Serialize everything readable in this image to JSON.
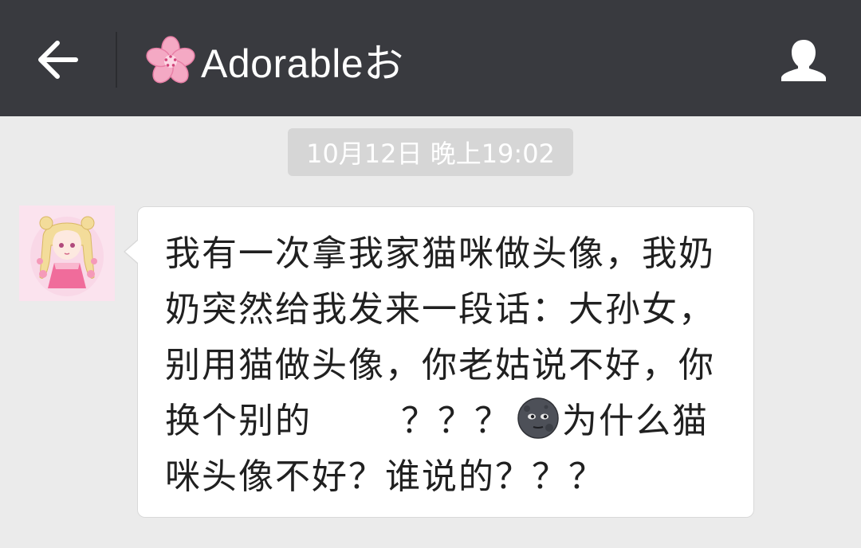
{
  "header": {
    "title": "Adorableお",
    "title_icon": "cherry-blossom-icon",
    "back_icon": "back-arrow-icon",
    "profile_icon": "person-icon"
  },
  "chat": {
    "timestamp": "10月12日 晚上19:02",
    "message": {
      "sender_avatar": "anime-girl-avatar",
      "lines": [
        "我有一次拿我家猫咪做头像，我奶",
        "奶突然给我发来一段话：大孙女，",
        "别用猫做头像，你老姑说不好，你",
        "换个别的",
        "？？？",
        "为什么猫",
        "咪头像不好？谁说的？？？"
      ],
      "inline_emoji": "new-moon-face-emoji"
    }
  },
  "colors": {
    "header_bg": "#393a3f",
    "chat_bg": "#ebebeb",
    "bubble_bg": "#ffffff",
    "timestamp_bg": "#d6d6d6"
  }
}
